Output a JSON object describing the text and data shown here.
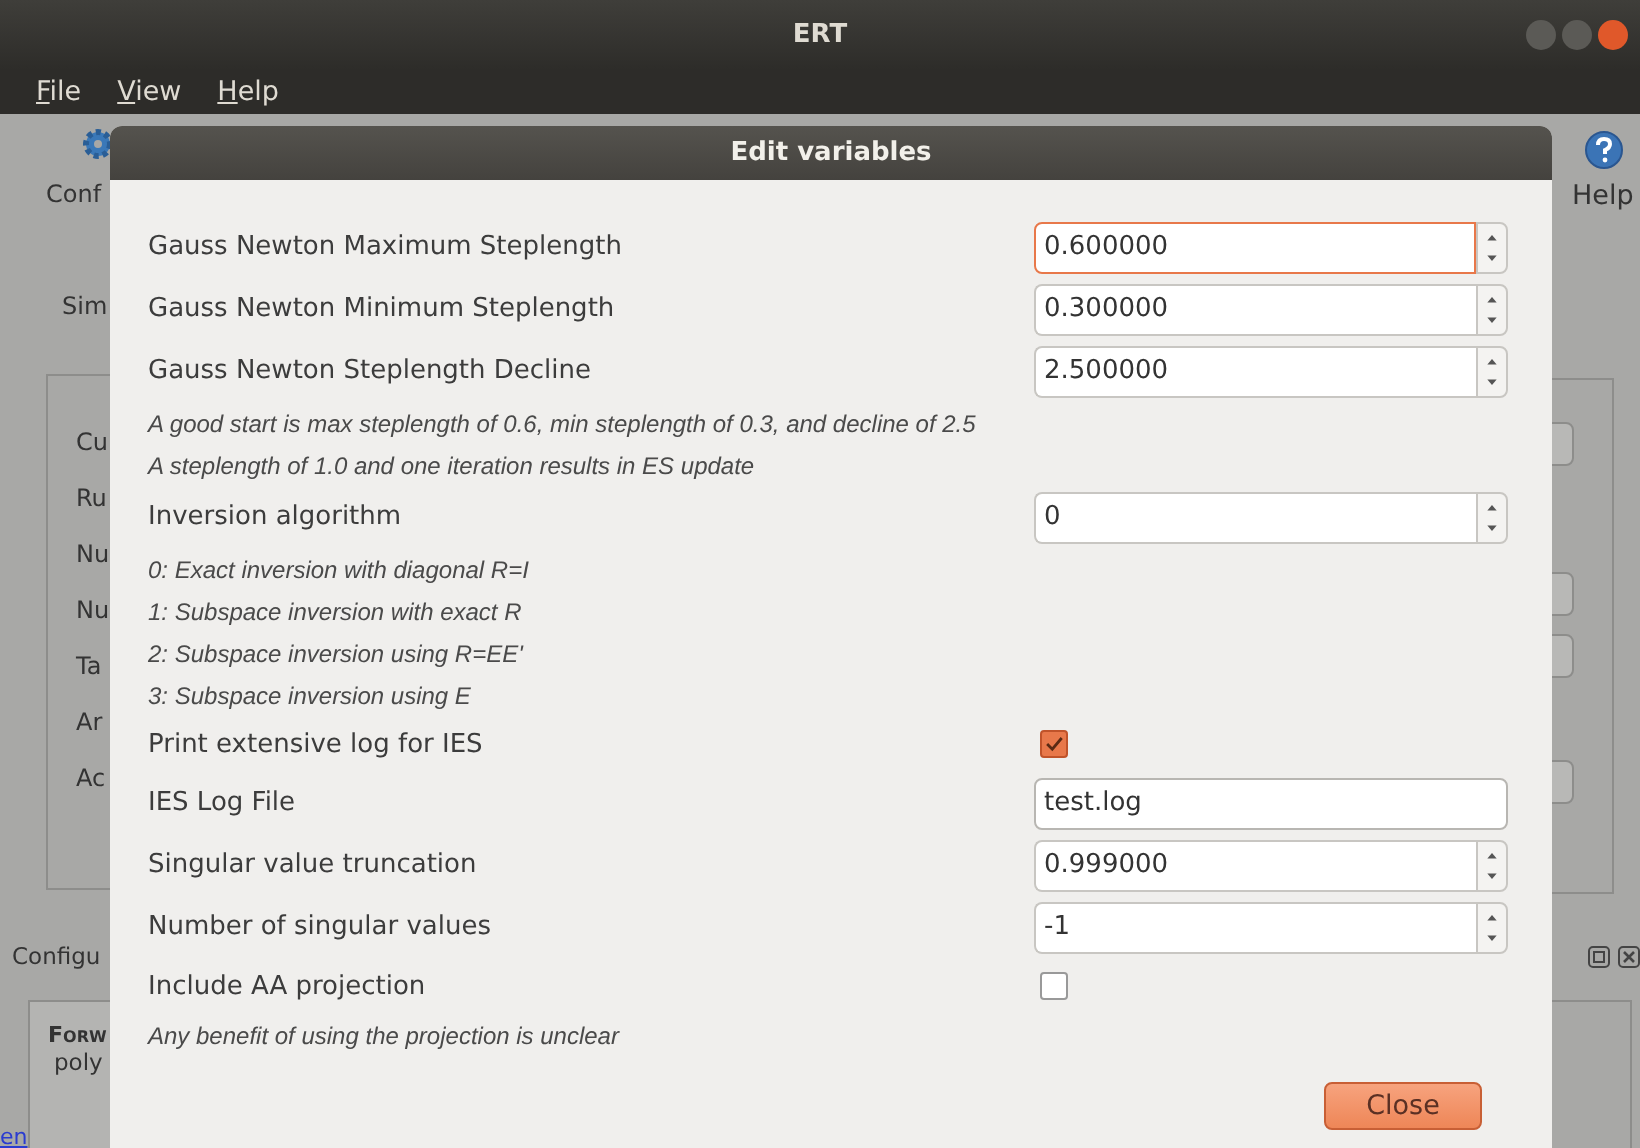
{
  "window": {
    "title": "ERT"
  },
  "menu": [
    "File",
    "View",
    "Help"
  ],
  "background": {
    "toolbar_left": "Conf",
    "toolbar_right": "Help",
    "section_label": "Sim",
    "panel_labels": [
      "Cu",
      "Ru",
      "Nu",
      "Nu",
      "Ta",
      "Ar",
      "Ac"
    ],
    "lower_label": "Configu",
    "lower_title": "Forw",
    "lower_sub": "poly",
    "link": "en"
  },
  "dialog": {
    "title": "Edit variables",
    "rows": [
      {
        "kind": "spin",
        "label": "Gauss Newton Maximum Steplength",
        "value": "0.600000",
        "focused": true
      },
      {
        "kind": "spin",
        "label": "Gauss Newton Minimum Steplength",
        "value": "0.300000",
        "focused": false
      },
      {
        "kind": "spin",
        "label": "Gauss Newton Steplength Decline",
        "value": "2.500000",
        "focused": false
      },
      {
        "kind": "note",
        "text": "A good start is max steplength of 0.6, min steplength of 0.3, and decline of 2.5"
      },
      {
        "kind": "note",
        "text": "A steplength of 1.0 and one iteration results in ES update"
      },
      {
        "kind": "spin",
        "label": "Inversion algorithm",
        "value": "0",
        "focused": false
      },
      {
        "kind": "note",
        "text": "0: Exact inversion with diagonal R=I"
      },
      {
        "kind": "note",
        "text": "1: Subspace inversion with exact R"
      },
      {
        "kind": "note",
        "text": "2: Subspace inversion using R=EE'"
      },
      {
        "kind": "note",
        "text": "3: Subspace inversion using E"
      },
      {
        "kind": "check",
        "label": "Print extensive log for IES",
        "checked": true
      },
      {
        "kind": "text",
        "label": "IES Log File",
        "value": "test.log"
      },
      {
        "kind": "spin",
        "label": "Singular value truncation",
        "value": "0.999000",
        "focused": false
      },
      {
        "kind": "spin",
        "label": "Number of singular values",
        "value": "-1",
        "focused": false
      },
      {
        "kind": "check",
        "label": "Include AA projection",
        "checked": false
      },
      {
        "kind": "note",
        "text": "Any benefit of using the projection is unclear"
      }
    ],
    "close_button": "Close"
  }
}
